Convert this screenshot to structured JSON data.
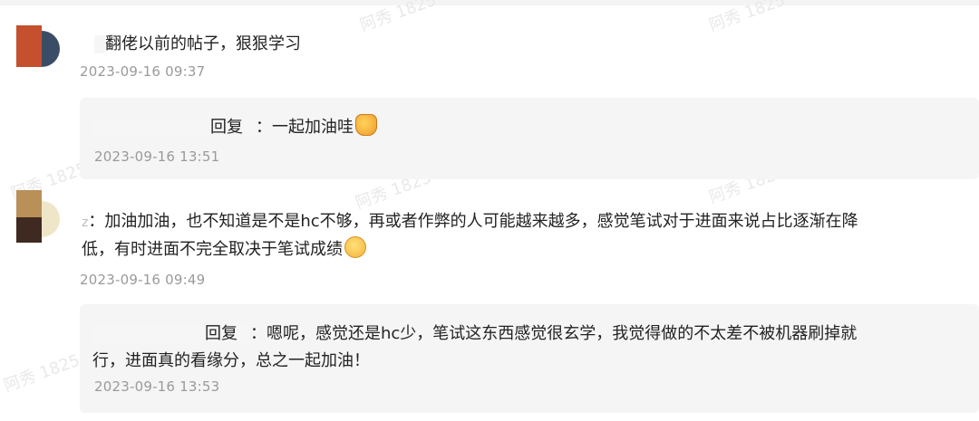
{
  "comments": [
    {
      "text": "翻佬以前的帖子，狠狠学习",
      "time": "2023-09-16 09:37",
      "reply": {
        "prefix": "回复",
        "sep": "：",
        "text": "一起加油哇",
        "emoji": "fist-emoji",
        "time": "2023-09-16 13:51"
      }
    },
    {
      "prefix": "：",
      "text_line1": "加油加油，也不知道是不是hc不够，再或者作弊的人可能越来越多，感觉笔试对于进面来说占比逐渐在降",
      "text_line2": "低，有时进面不完全取决于笔试成绩",
      "emoji": "pleading-face-emoji",
      "time": "2023-09-16 09:49",
      "reply": {
        "prefix": "回复",
        "sep": "：",
        "text_line1": "嗯呢，感觉还是hc少，笔试这东西感觉很玄学，我觉得做的不太差不被机器刷掉就",
        "text_line2": "行，进面真的看缘分，总之一起加油！",
        "time": "2023-09-16 13:53"
      }
    }
  ],
  "watermark": "阿秀 1825",
  "colors": {
    "background": "#ffffff",
    "reply_bg": "#f5f5f5",
    "time": "#9a9a9a",
    "text": "#222222"
  }
}
